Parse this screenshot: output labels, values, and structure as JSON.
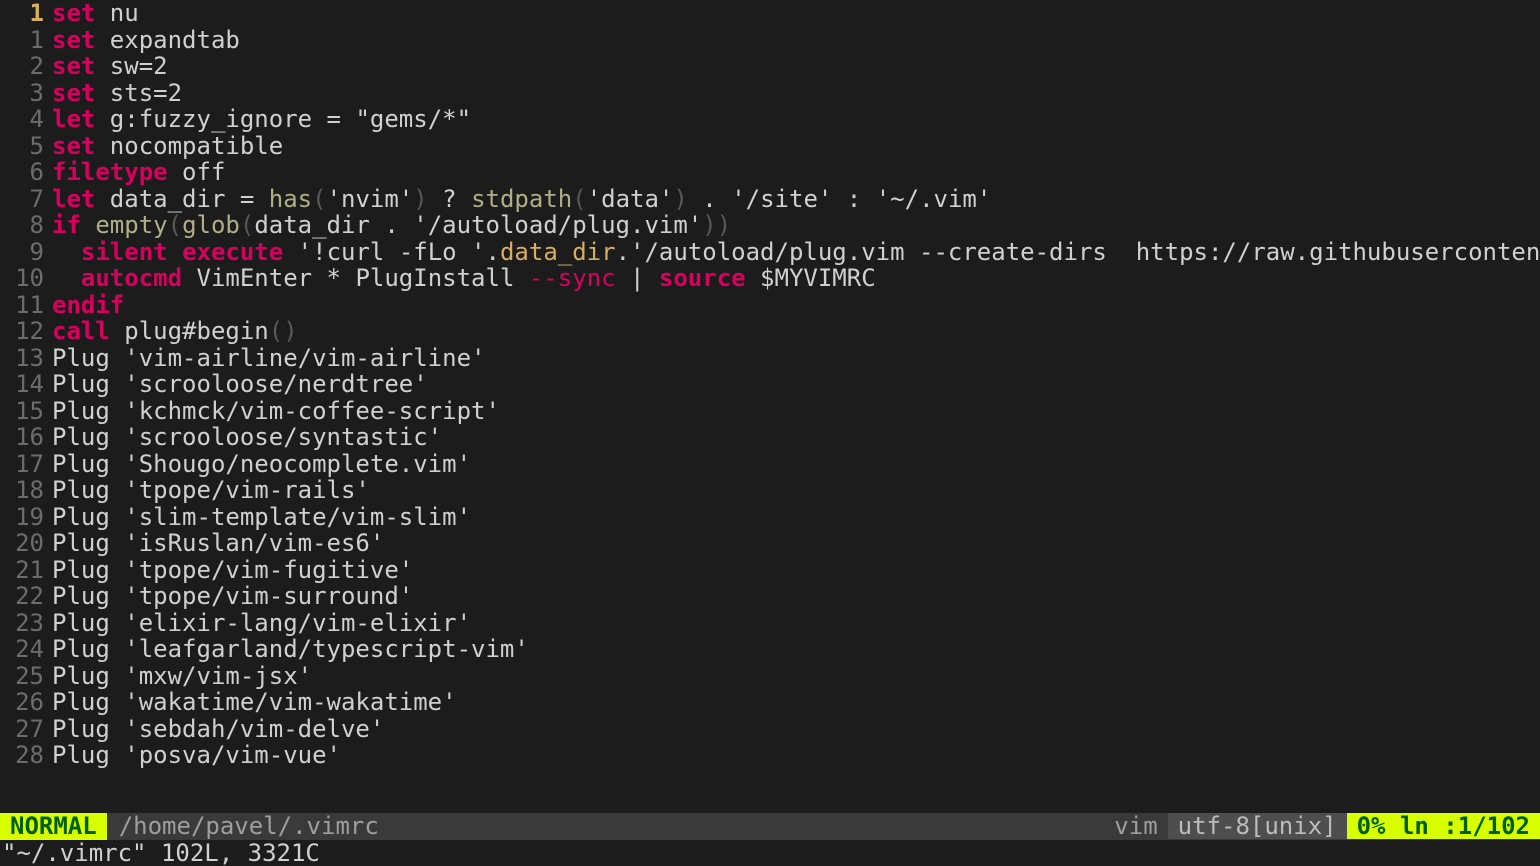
{
  "gutter": {
    "current": "1",
    "rel": [
      "1",
      "2",
      "3",
      "4",
      "5",
      "6",
      "7",
      "8",
      "9",
      "10",
      "11",
      "12",
      "13",
      "14",
      "15",
      "16",
      "17",
      "18",
      "19",
      "20",
      "21",
      "22",
      "23",
      "24",
      "25",
      "26",
      "27",
      "28"
    ]
  },
  "code": {
    "l0_set": "set",
    "l0_rest": " nu",
    "l1_set": "set",
    "l1_rest": " expandtab",
    "l2_set": "set",
    "l2_rest": " sw=2",
    "l3_set": "set",
    "l3_rest": " sts=2",
    "l4_let": "let",
    "l4_rest": " g:fuzzy_ignore = \"gems/*\"",
    "l5_set": "set",
    "l5_rest": " nocompatible",
    "l6_filetype": "filetype",
    "l6_rest": " off",
    "l7_let": "let",
    "l7_a": " data_dir = ",
    "l7_has": "has",
    "l7_p1": "(",
    "l7_s1": "'nvim'",
    "l7_p2": ")",
    "l7_b": " ? ",
    "l7_stdpath": "stdpath",
    "l7_p3": "(",
    "l7_s2": "'data'",
    "l7_p4": ")",
    "l7_c": " . ",
    "l7_s3": "'/site'",
    "l7_d": " : ",
    "l7_s4": "'~/.vim'",
    "l8_if": "if",
    "l8_a": " ",
    "l8_empty": "empty",
    "l8_p1": "(",
    "l8_glob": "glob",
    "l8_p2": "(",
    "l8_b": "data_dir . ",
    "l8_s1": "'/autoload/plug.vim'",
    "l8_p3": "))",
    "l9_indent": "  ",
    "l9_silent": "silent",
    "l9_sp": " ",
    "l9_execute": "execute",
    "l9_a": " '!curl -fLo '.",
    "l9_var": "data_dir",
    "l9_b": ".'/autoload/plug.vim --create-dirs  https://raw.githubuserconten",
    "l10_indent": "  ",
    "l10_autocmd": "autocmd",
    "l10_a": " VimEnter * PlugInstall ",
    "l10_sync": "--sync",
    "l10_b": " | ",
    "l10_source": "source",
    "l10_c": " $MYVIMRC",
    "l11_endif": "endif",
    "l12_call": "call",
    "l12_a": " plug#begin",
    "l12_p": "()",
    "plug": [
      "Plug 'vim-airline/vim-airline'",
      "Plug 'scrooloose/nerdtree'",
      "Plug 'kchmck/vim-coffee-script'",
      "Plug 'scrooloose/syntastic'",
      "Plug 'Shougo/neocomplete.vim'",
      "Plug 'tpope/vim-rails'",
      "Plug 'slim-template/vim-slim'",
      "Plug 'isRuslan/vim-es6'",
      "Plug 'tpope/vim-fugitive'",
      "Plug 'tpope/vim-surround'",
      "Plug 'elixir-lang/vim-elixir'",
      "Plug 'leafgarland/typescript-vim'",
      "Plug 'mxw/vim-jsx'",
      "Plug 'wakatime/vim-wakatime'",
      "Plug 'sebdah/vim-delve'",
      "Plug 'posva/vim-vue'"
    ]
  },
  "status": {
    "mode": "NORMAL",
    "file": "/home/pavel/.vimrc",
    "filetype": "vim",
    "encoding": "utf-8[unix]",
    "position": "0% ln :1/102"
  },
  "cmdline": "\"~/.vimrc\" 102L, 3321C"
}
